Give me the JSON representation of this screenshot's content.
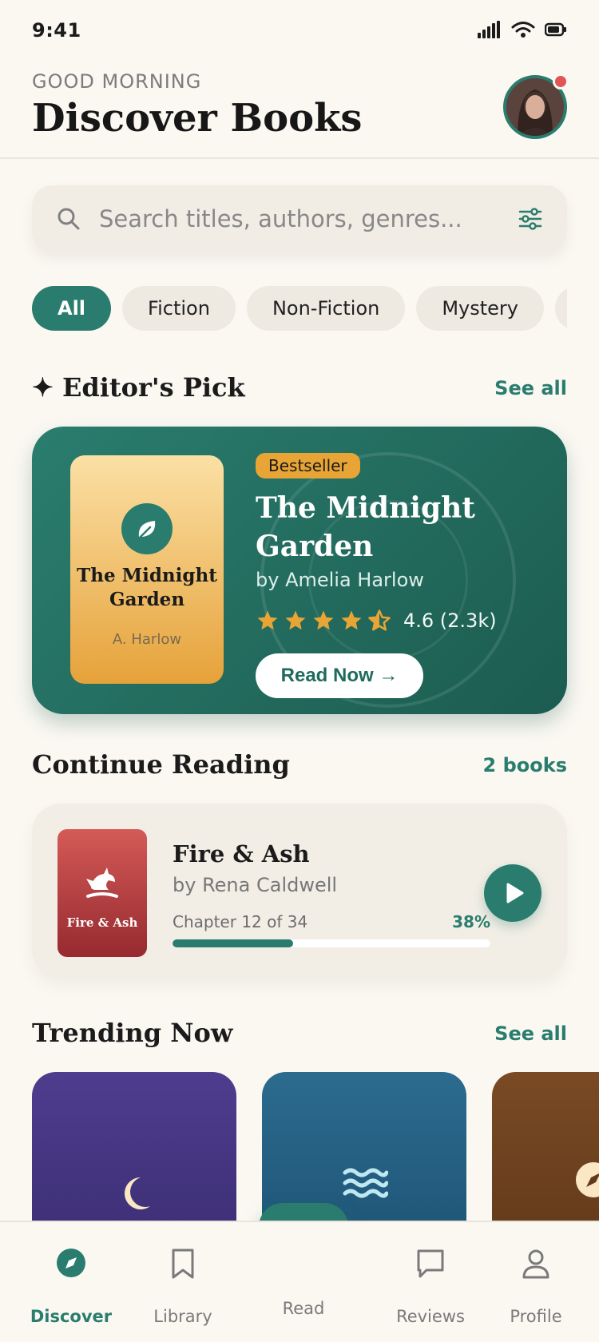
{
  "status": {
    "time": "9:41"
  },
  "header": {
    "greeting": "GOOD MORNING",
    "title": "Discover Books"
  },
  "search": {
    "placeholder": "Search titles, authors, genres..."
  },
  "chips": [
    "All",
    "Fiction",
    "Non-Fiction",
    "Mystery"
  ],
  "editors_pick": {
    "section_title": "Editor's Pick",
    "see_all": "See all",
    "cover_title": "The Midnight Garden",
    "cover_author": "A. Harlow",
    "badge": "Bestseller",
    "title": "The Midnight Garden",
    "author": "by Amelia Harlow",
    "rating": 4.6,
    "rating_text": "4.6 (2.3k)",
    "cta": "Read Now →"
  },
  "continue_reading": {
    "section_title": "Continue Reading",
    "count_label": "2 books",
    "cover_title": "Fire & Ash",
    "title": "Fire & Ash",
    "author": "by Rena Caldwell",
    "chapter": "Chapter 12 of 34",
    "progress_text": "38%",
    "progress": 0.38
  },
  "trending": {
    "section_title": "Trending Now",
    "see_all": "See all"
  },
  "bottom_nav": {
    "discover": "Discover",
    "library": "Library",
    "read": "Read",
    "reviews": "Reviews",
    "profile": "Profile"
  },
  "colors": {
    "accent": "#2A7D6E",
    "badge": "#E8A435",
    "notify": "#E05555"
  }
}
